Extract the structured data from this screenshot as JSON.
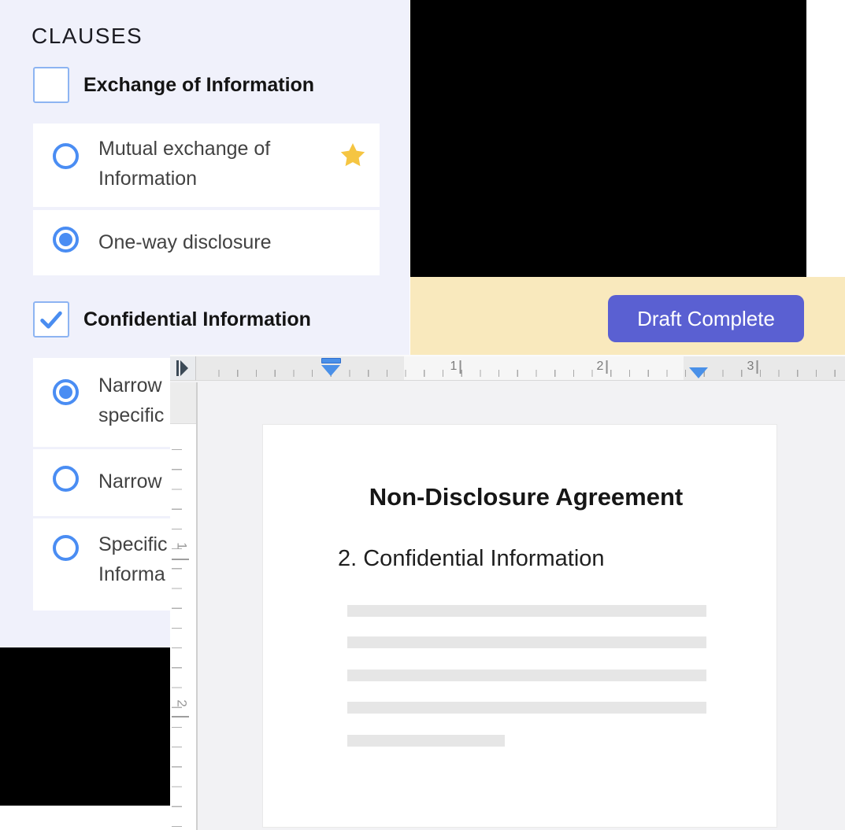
{
  "panel": {
    "title": "CLAUSES",
    "sections": [
      {
        "label": "Exchange of Information",
        "checked": false,
        "options": [
          {
            "lines": [
              "Mutual exchange of",
              "Information"
            ],
            "selected": false,
            "starred": true
          },
          {
            "lines": [
              "One-way disclosure"
            ],
            "selected": true,
            "starred": false
          }
        ]
      },
      {
        "label": "Confidential Information",
        "checked": true,
        "options": [
          {
            "lines": [
              "Narrow",
              "specific"
            ],
            "selected": true,
            "starred": false
          },
          {
            "lines": [
              "Narrow"
            ],
            "selected": false,
            "starred": false
          },
          {
            "lines": [
              "Specific",
              "Informa"
            ],
            "selected": false,
            "starred": false
          }
        ]
      }
    ]
  },
  "banner": {
    "button_label": "Draft Complete"
  },
  "editor": {
    "horizontal_ruler_numbers": [
      "1",
      "2",
      "3"
    ],
    "vertical_ruler_numbers": [
      "1",
      "2"
    ],
    "icons": {
      "corner": "tab-stop-selector-icon",
      "markers": [
        "first-line-indent-marker",
        "left-indent-marker",
        "right-indent-marker"
      ]
    },
    "document": {
      "title": "Non-Disclosure Agreement",
      "heading": "2. Confidential Information",
      "placeholder_lines": 5
    }
  },
  "colors": {
    "panel_background": "#f0f1fb",
    "accent_blue": "#4a8df3",
    "star_gold": "#f5c542",
    "banner_yellow": "#f9e9bd",
    "button_purple": "#5a60d2",
    "black_block": "#000000",
    "page_white": "#ffffff",
    "placeholder_gray": "#e6e6e6"
  }
}
